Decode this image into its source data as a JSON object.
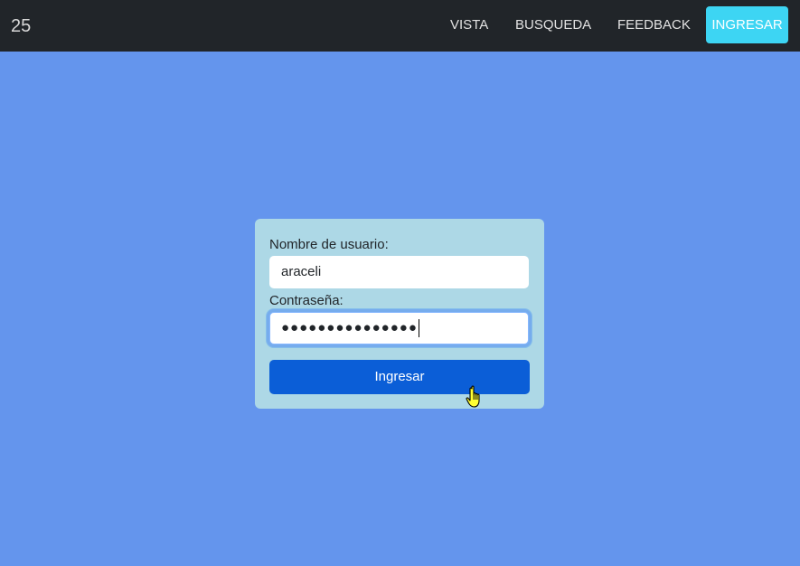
{
  "navbar": {
    "brand": "25",
    "links": {
      "vista": "VISTA",
      "busqueda": "BUSQUEDA",
      "feedback": "FEEDBACK",
      "ingresar": "INGRESAR"
    }
  },
  "login": {
    "username_label": "Nombre de usuario:",
    "username_value": "araceli",
    "password_label": "Contraseña:",
    "password_value": "●●●●●●●●●●●●●●●",
    "submit_label": "Ingresar"
  },
  "colors": {
    "page_background": "#6495ed",
    "navbar_background": "#212529",
    "card_background": "#add8e6",
    "primary_button": "#0b5ed7",
    "nav_cta_button": "#3dd5f3"
  },
  "icons": {
    "pointer": "hand-pointer-icon"
  }
}
